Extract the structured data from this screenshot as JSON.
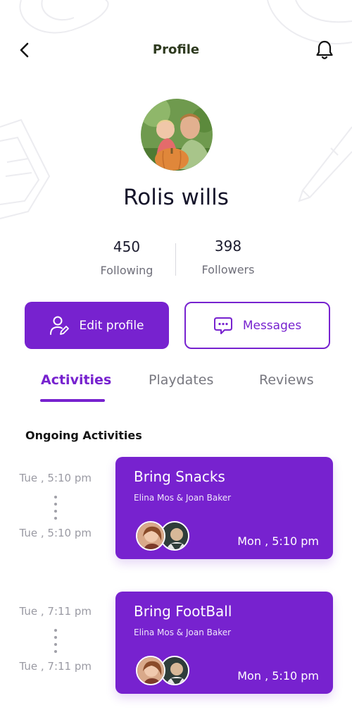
{
  "header": {
    "title": "Profile",
    "back_icon": "chevron-left-icon",
    "bell_icon": "bell-icon"
  },
  "profile": {
    "name": "Rolis wills",
    "following_count": "450",
    "following_label": "Following",
    "followers_count": "398",
    "followers_label": "Followers"
  },
  "actions": {
    "edit_label": "Edit profile",
    "edit_icon": "user-edit-icon",
    "messages_label": "Messages",
    "messages_icon": "chat-bubble-icon"
  },
  "tabs": [
    {
      "label": "Activities",
      "active": true
    },
    {
      "label": "Playdates",
      "active": false
    },
    {
      "label": "Reviews",
      "active": false
    }
  ],
  "section_title": "Ongoing Activities",
  "activities": [
    {
      "start": "Tue , 5:10 pm",
      "end": "Tue , 5:10 pm",
      "title": "Bring Snacks",
      "people": "Elina Mos & Joan Baker",
      "time": "Mon , 5:10 pm"
    },
    {
      "start": "Tue , 7:11 pm",
      "end": "Tue , 7:11 pm",
      "title": "Bring FootBall",
      "people": "Elina Mos & Joan Baker",
      "time": "Mon , 5:10 pm"
    }
  ],
  "colors": {
    "accent": "#7722cf",
    "muted_text": "#77777f",
    "header_title": "#2e3a1f"
  }
}
